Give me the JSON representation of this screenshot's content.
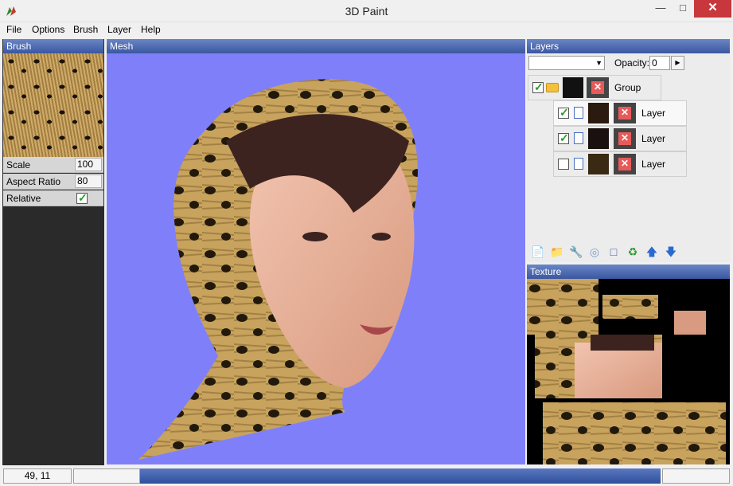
{
  "window": {
    "title": "3D Paint"
  },
  "menu": [
    "File",
    "Options",
    "Brush",
    "Layer",
    "Help"
  ],
  "brush_panel": {
    "header": "Brush",
    "texture": "leopard-fur-texture",
    "properties": [
      {
        "label": "Scale",
        "value": "100"
      },
      {
        "label": "Aspect Ratio",
        "value": "80"
      },
      {
        "label": "Relative",
        "checked": true
      }
    ]
  },
  "mesh_panel": {
    "header": "Mesh",
    "background": "#7f80f9"
  },
  "layers_panel": {
    "header": "Layers",
    "opacity_label": "Opacity:",
    "opacity_value": "0",
    "group": {
      "name": "Group",
      "visible": true
    },
    "layers": [
      {
        "name": "Layer",
        "visible": true
      },
      {
        "name": "Layer",
        "visible": true
      },
      {
        "name": "Layer",
        "visible": false
      }
    ],
    "toolbar_icons": [
      "new-layer-icon",
      "open-folder-icon",
      "wrench-icon",
      "circle-select-icon",
      "rect-select-icon",
      "recycle-icon",
      "move-up-icon",
      "move-down-icon"
    ]
  },
  "texture_panel": {
    "header": "Texture"
  },
  "statusbar": {
    "coords": "49, 11"
  },
  "colors": {
    "accent": "#3a57a0",
    "close": "#c7373c"
  }
}
